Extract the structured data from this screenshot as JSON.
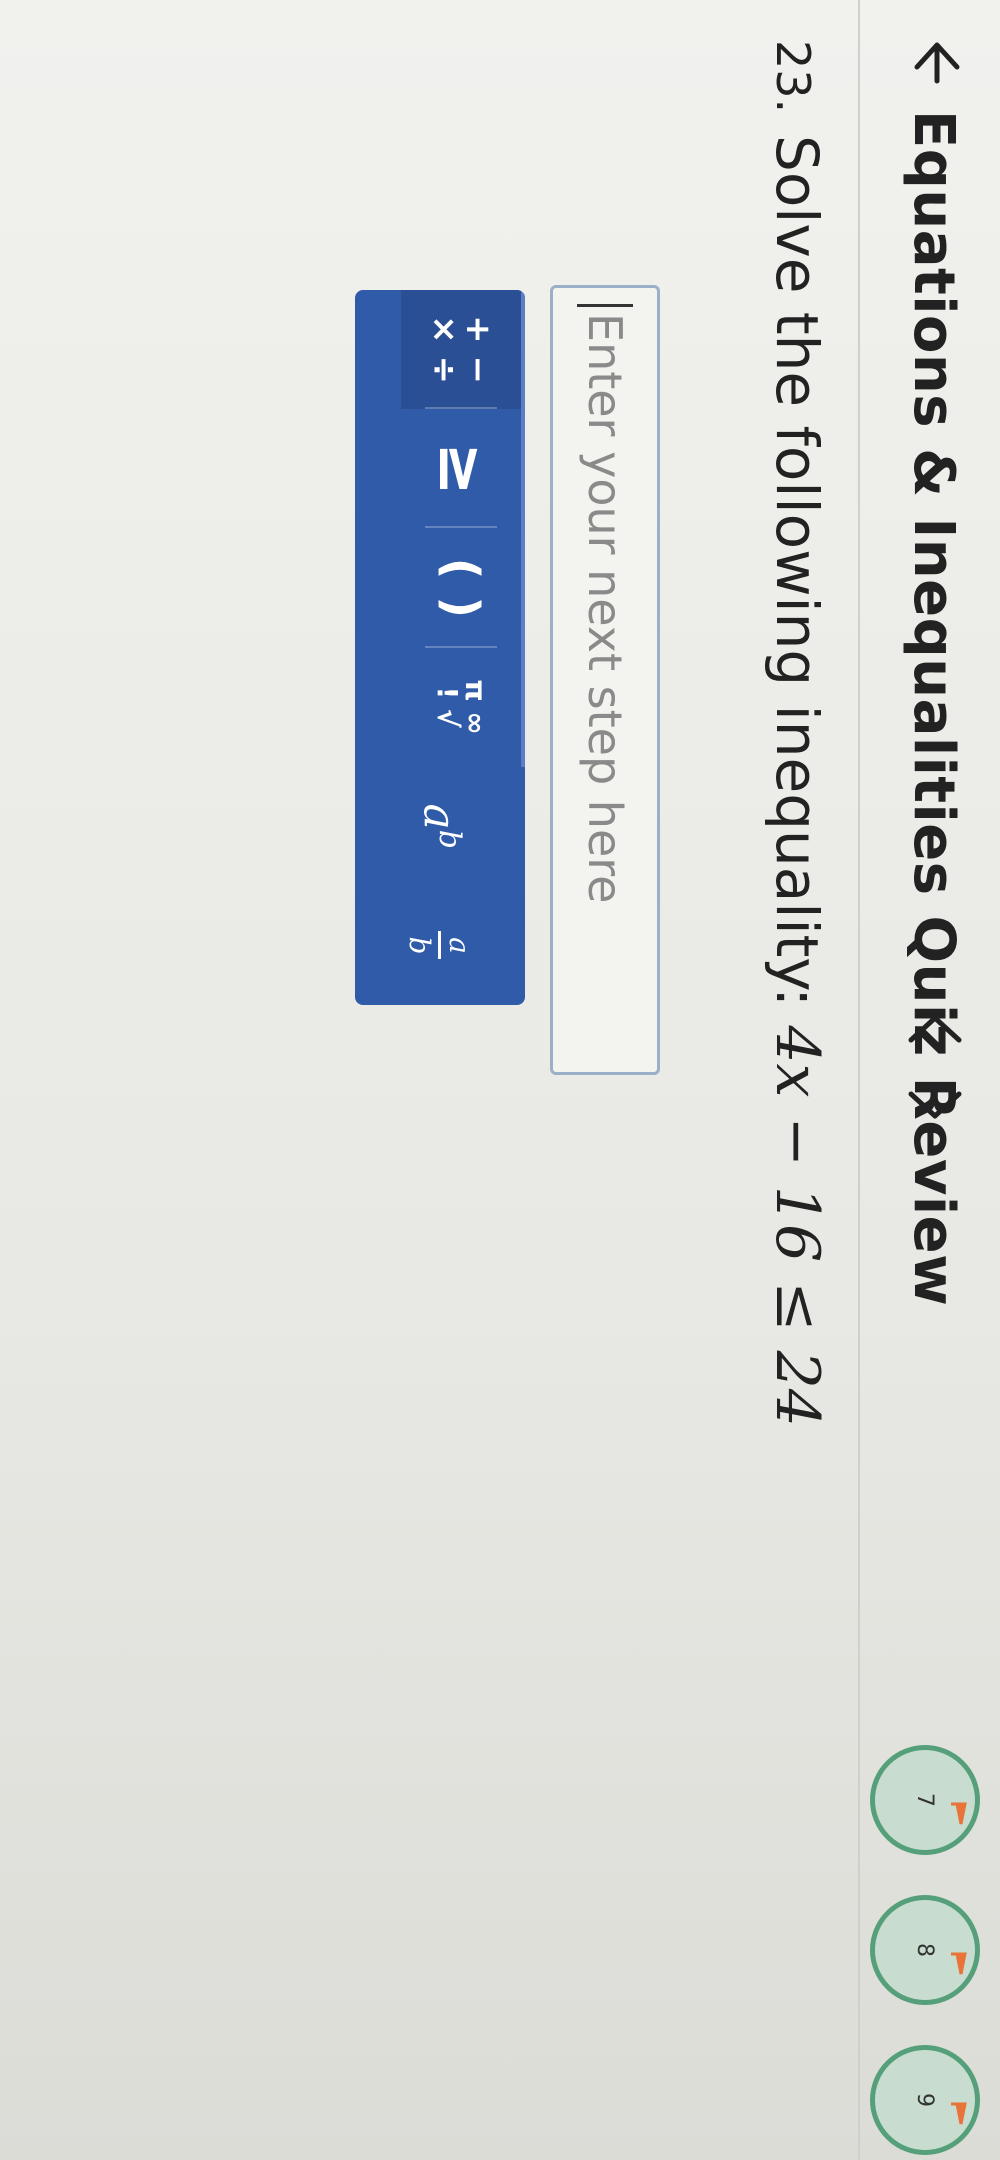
{
  "header": {
    "title": "Equations & Inequalities Quiz Review",
    "back_icon": "arrow-left-icon",
    "prev_icon": "chevron-left-icon",
    "next_icon": "chevron-right-icon",
    "question_bubbles": [
      {
        "label": "7",
        "flag_color": "#e8743a"
      },
      {
        "label": "8",
        "flag_color": "#e8743a"
      },
      {
        "label": "9",
        "flag_color": "#e8743a"
      }
    ]
  },
  "question": {
    "number": "23.",
    "prompt": "Solve the following inequality: ",
    "expression": "4x − 16 ≤ 24"
  },
  "answer": {
    "placeholder": "Enter your next step here"
  },
  "keyboard": {
    "background_color": "#2f5ba8",
    "keys": [
      {
        "name": "operations-key",
        "line1": "+ −",
        "line2": "× ÷"
      },
      {
        "name": "inequality-key",
        "symbol": "≥"
      },
      {
        "name": "parentheses-key",
        "symbol": "( )"
      },
      {
        "name": "constants-key",
        "line1": "π ∞",
        "line2": "! √"
      },
      {
        "name": "exponent-key",
        "base": "a",
        "exponent": "b"
      },
      {
        "name": "fraction-key",
        "numerator": "a",
        "denominator": "b"
      }
    ]
  }
}
